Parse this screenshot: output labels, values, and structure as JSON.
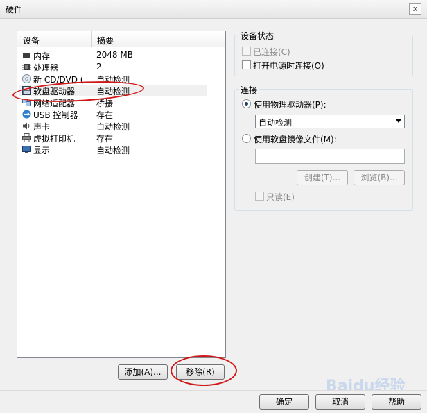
{
  "window": {
    "title": "硬件",
    "close_glyph": "x"
  },
  "device_list": {
    "headers": {
      "device": "设备",
      "summary": "摘要"
    },
    "rows": [
      {
        "name": "内存",
        "summary": "2048 MB",
        "icon": "memory-icon"
      },
      {
        "name": "处理器",
        "summary": "2",
        "icon": "processor-icon"
      },
      {
        "name": "新 CD/DVD (...",
        "summary": "自动检测",
        "icon": "cd-dvd-icon"
      },
      {
        "name": "软盘驱动器",
        "summary": "自动检测",
        "icon": "floppy-drive-icon"
      },
      {
        "name": "网络适配器",
        "summary": "桥接",
        "icon": "network-adapter-icon"
      },
      {
        "name": "USB 控制器",
        "summary": "存在",
        "icon": "usb-icon"
      },
      {
        "name": "声卡",
        "summary": "自动检测",
        "icon": "sound-card-icon"
      },
      {
        "name": "虚拟打印机",
        "summary": "存在",
        "icon": "printer-icon"
      },
      {
        "name": "显示",
        "summary": "自动检测",
        "icon": "display-icon"
      }
    ],
    "selected_index": 3
  },
  "device_status": {
    "label": "设备状态",
    "connected_label": "已连接(C)",
    "connect_at_power_on_label": "打开电源时连接(O)"
  },
  "connection": {
    "label": "连接",
    "physical_drive_label": "使用物理驱动器(P):",
    "physical_drive_value": "自动检测",
    "image_file_label": "使用软盘镜像文件(M):",
    "image_file_value": "",
    "create_button": "创建(T)...",
    "browse_button": "浏览(B)...",
    "read_only_label": "只读(E)"
  },
  "list_buttons": {
    "add": "添加(A)...",
    "remove": "移除(R)"
  },
  "dialog_buttons": {
    "ok": "确定",
    "cancel": "取消",
    "help": "帮助"
  },
  "watermark": {
    "text": "Baidu经验"
  },
  "colors": {
    "annotation_red": "#d01818",
    "selection_bg": "#f0f0f0"
  }
}
